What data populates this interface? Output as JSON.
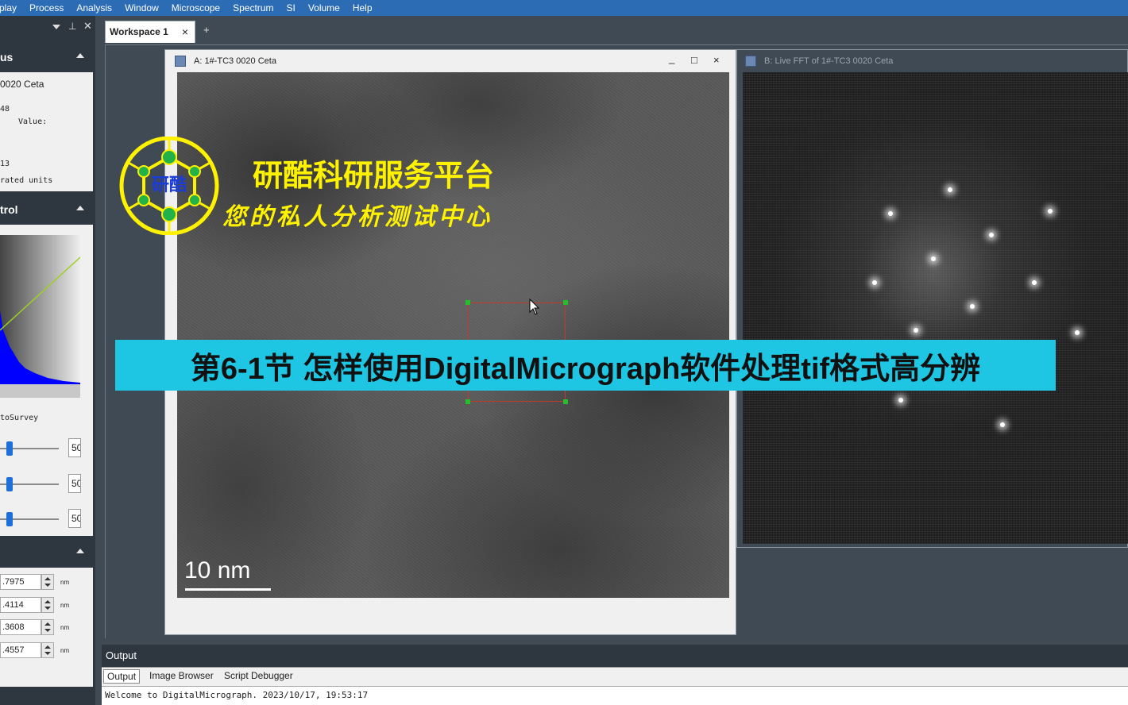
{
  "menu": [
    "play",
    "Process",
    "Analysis",
    "Window",
    "Microscope",
    "Spectrum",
    "SI",
    "Volume",
    "Help"
  ],
  "left_panel": {
    "status": {
      "title": "us",
      "lines": [
        "0020 Ceta",
        "48",
        "Value:",
        "13",
        "rated units"
      ]
    },
    "control": {
      "title": "trol",
      "mode_label": "toSurvey",
      "sliders": [
        "50",
        "50",
        "50"
      ]
    },
    "fields": [
      {
        "value": ".7975",
        "unit": "nm"
      },
      {
        "value": ".4114",
        "unit": "nm"
      },
      {
        "value": ".3608",
        "unit": "nm"
      },
      {
        "value": ".4557",
        "unit": "nm"
      }
    ]
  },
  "workspace": {
    "tab_label": "Workspace 1",
    "close": "×",
    "add": "+"
  },
  "window_a": {
    "title": "A: 1#-TC3 0020 Ceta",
    "minimize": "_",
    "maximize": "□",
    "close": "×",
    "scale_label": "10 nm"
  },
  "window_b": {
    "title": "B: Live FFT of 1#-TC3 0020 Ceta"
  },
  "logo": {
    "text": "研酷",
    "brand_line1": "研酷科研服务平台",
    "brand_line2": "您的私人分析测试中心"
  },
  "banner": {
    "text": "第6-1节 怎样使用DigitalMicrograph软件处理tif格式高分辨"
  },
  "output": {
    "header": "Output",
    "tabs": [
      "Output",
      "Image Browser",
      "Script Debugger"
    ],
    "log": "Welcome to DigitalMicrograph.  2023/10/17, 19:53:17"
  },
  "colors": {
    "menubar": "#2b6cb5",
    "banner": "#1fc6e3",
    "brand": "#fff200",
    "roi": "#c23a2a",
    "roi_handle": "#22c02a"
  }
}
